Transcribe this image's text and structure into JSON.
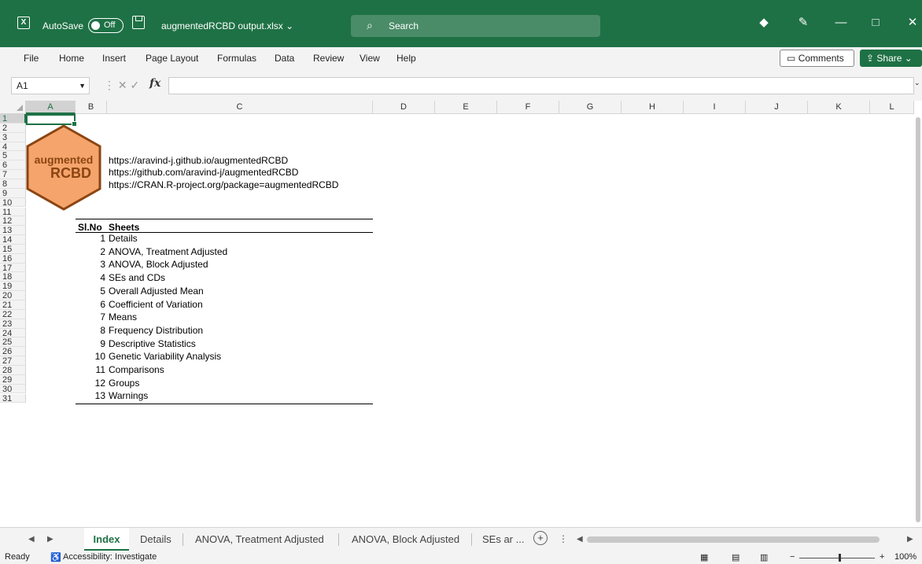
{
  "titlebar": {
    "app_icon": "excel-logo-icon",
    "autosave_label": "AutoSave",
    "autosave_state": "Off",
    "filename": "augmentedRCBD output.xlsx ⌄",
    "search_placeholder": "Search",
    "accent_color": "#1e7145"
  },
  "ribbon": {
    "tabs": [
      "File",
      "Home",
      "Insert",
      "Page Layout",
      "Formulas",
      "Data",
      "Review",
      "View",
      "Help"
    ],
    "comments_label": "Comments",
    "share_label": "Share"
  },
  "formula_bar": {
    "name_box": "A1",
    "fx_label": "fx",
    "value": ""
  },
  "columns": [
    "A",
    "B",
    "C",
    "D",
    "E",
    "F",
    "G",
    "H",
    "I",
    "J",
    "K",
    "L"
  ],
  "rows": [
    "1",
    "2",
    "3",
    "4",
    "5",
    "6",
    "7",
    "8",
    "9",
    "10",
    "11",
    "12",
    "13",
    "14",
    "15",
    "16",
    "17",
    "18",
    "19",
    "20",
    "21",
    "22",
    "23",
    "24",
    "25",
    "26",
    "27",
    "28",
    "29",
    "30",
    "31"
  ],
  "logo": {
    "line1": "augmented",
    "line2": "RCBD"
  },
  "links": [
    "https://aravind-j.github.io/augmentedRCBD",
    "https://github.com/aravind-j/augmentedRCBD",
    "https://CRAN.R-project.org/package=augmentedRCBD"
  ],
  "index_table": {
    "headers": [
      "Sl.No",
      "Sheets"
    ],
    "rows": [
      {
        "no": "1",
        "sheet": "Details"
      },
      {
        "no": "2",
        "sheet": "ANOVA, Treatment Adjusted"
      },
      {
        "no": "3",
        "sheet": "ANOVA, Block Adjusted"
      },
      {
        "no": "4",
        "sheet": "SEs and CDs"
      },
      {
        "no": "5",
        "sheet": "Overall Adjusted Mean"
      },
      {
        "no": "6",
        "sheet": "Coefficient of Variation"
      },
      {
        "no": "7",
        "sheet": "Means"
      },
      {
        "no": "8",
        "sheet": "Frequency Distribution"
      },
      {
        "no": "9",
        "sheet": "Descriptive Statistics"
      },
      {
        "no": "10",
        "sheet": "Genetic Variability Analysis"
      },
      {
        "no": "11",
        "sheet": "Comparisons"
      },
      {
        "no": "12",
        "sheet": "Groups"
      },
      {
        "no": "13",
        "sheet": "Warnings"
      }
    ]
  },
  "sheet_tabs": [
    "Index",
    "Details",
    "ANOVA, Treatment Adjusted",
    "ANOVA, Block Adjusted",
    "SEs ar ..."
  ],
  "status": {
    "ready": "Ready",
    "accessibility": "Accessibility: Investigate",
    "zoom": "100%"
  }
}
